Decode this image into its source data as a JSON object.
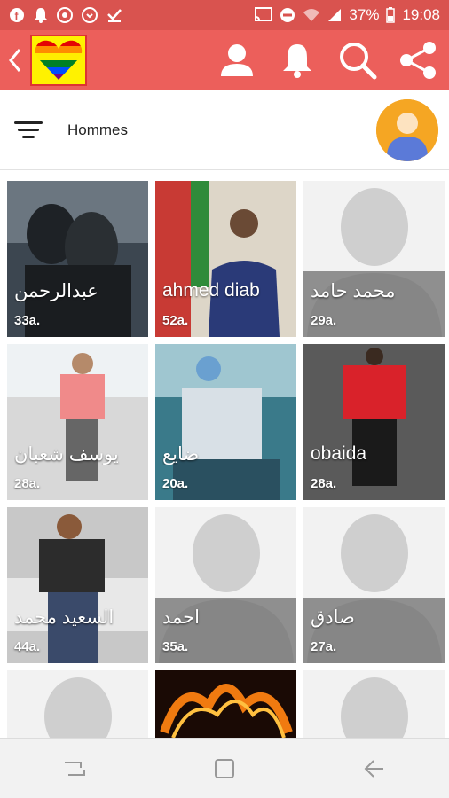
{
  "status_bar": {
    "battery_percent": "37%",
    "time": "19:08",
    "notification_icons": [
      "facebook-icon",
      "bell-icon",
      "chrome-icon",
      "opera-icon",
      "download-done-icon"
    ],
    "system_icons": [
      "cast-icon",
      "dnd-icon",
      "wifi-icon",
      "signal-icon",
      "battery-icon"
    ]
  },
  "app_bar": {
    "back_icon": "chevron-left-icon",
    "logo": "rainbow-heart-logo",
    "actions": [
      "profile-icon",
      "bell-icon",
      "search-icon",
      "share-icon"
    ]
  },
  "filter": {
    "label": "Hommes",
    "icon": "filter-icon"
  },
  "colors": {
    "status_bar": "#d9534f",
    "app_bar": "#ec5f5b",
    "overlay": "#6e6e6e",
    "avatar_bg": "#f5a623"
  },
  "profiles": [
    {
      "name": "عبدالرحمن",
      "age": "33a.",
      "has_photo": true
    },
    {
      "name": "ahmed diab",
      "age": "52a.",
      "has_photo": true
    },
    {
      "name": "محمد حامد",
      "age": "29a.",
      "has_photo": false
    },
    {
      "name": "يوسف شعبان",
      "age": "28a.",
      "has_photo": true
    },
    {
      "name": "ضايع",
      "age": "20a.",
      "has_photo": true
    },
    {
      "name": "obaida",
      "age": "28a.",
      "has_photo": true
    },
    {
      "name": "السعيد محمد",
      "age": "44a.",
      "has_photo": true
    },
    {
      "name": "احمد",
      "age": "35a.",
      "has_photo": false
    },
    {
      "name": "صادق",
      "age": "27a.",
      "has_photo": false
    },
    {
      "name": "",
      "age": "",
      "has_photo": false
    },
    {
      "name": "",
      "age": "",
      "has_photo": true
    },
    {
      "name": "",
      "age": "",
      "has_photo": false
    }
  ],
  "nav_bar": [
    "recent-apps-icon",
    "home-icon",
    "back-icon"
  ]
}
